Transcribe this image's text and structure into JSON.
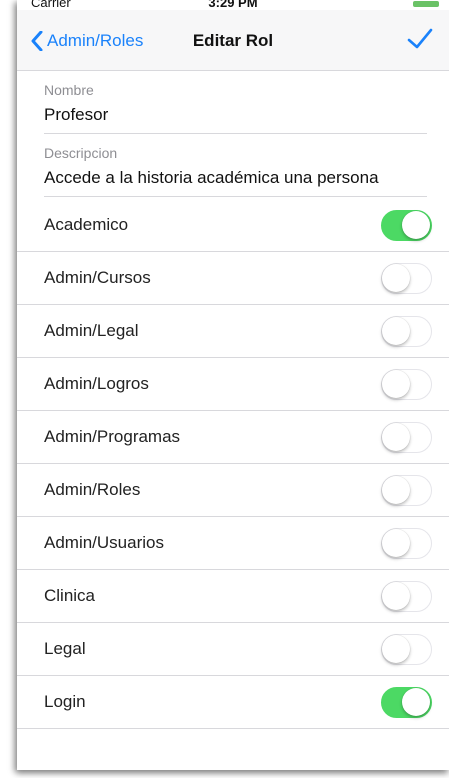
{
  "status_bar": {
    "carrier": "Carrier",
    "time": "3:29 PM"
  },
  "nav": {
    "back_label": "Admin/Roles",
    "title": "Editar Rol"
  },
  "form": {
    "name_label": "Nombre",
    "name_value": "Profesor",
    "description_label": "Descripcion",
    "description_value": "Accede a la historia académica una persona"
  },
  "toggles": [
    {
      "label": "Academico",
      "on": true
    },
    {
      "label": "Admin/Cursos",
      "on": false
    },
    {
      "label": "Admin/Legal",
      "on": false
    },
    {
      "label": "Admin/Logros",
      "on": false
    },
    {
      "label": "Admin/Programas",
      "on": false
    },
    {
      "label": "Admin/Roles",
      "on": false
    },
    {
      "label": "Admin/Usuarios",
      "on": false
    },
    {
      "label": "Clinica",
      "on": false
    },
    {
      "label": "Legal",
      "on": false
    },
    {
      "label": "Login",
      "on": true
    }
  ],
  "colors": {
    "accent": "#1a82fb",
    "switch_on": "#4cd964"
  }
}
